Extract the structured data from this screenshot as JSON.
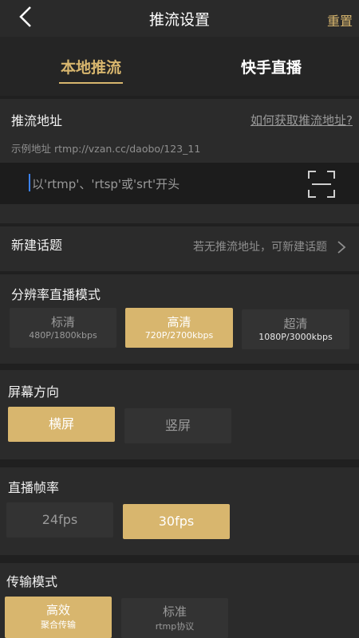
{
  "header": {
    "title": "推流设置",
    "reset_label": "重置"
  },
  "tabs": [
    {
      "label": "本地推流",
      "active": true
    },
    {
      "label": "快手直播",
      "active": false
    }
  ],
  "push_url": {
    "label": "推流地址",
    "help_link": "如何获取推流地址?",
    "example": "示例地址 rtmp://vzan.cc/daobo/123_11",
    "placeholder": "以'rtmp'、'rtsp'或'srt'开头",
    "value": ""
  },
  "new_topic": {
    "label": "新建话题",
    "hint": "若无推流地址，可新建话题"
  },
  "resolution": {
    "label": "分辨率直播模式",
    "options": [
      {
        "title": "标清",
        "sub": "480P/1800kbps"
      },
      {
        "title": "高清",
        "sub": "720P/2700kbps"
      },
      {
        "title": "超清",
        "sub": "1080P/3000kbps"
      }
    ],
    "selected": "高清"
  },
  "orientation": {
    "label": "屏幕方向",
    "options": [
      "横屏",
      "竖屏"
    ],
    "selected": "横屏"
  },
  "framerate": {
    "label": "直播帧率",
    "options": [
      "24fps",
      "30fps"
    ],
    "selected": "30fps"
  },
  "transport": {
    "label": "传输模式",
    "options": [
      {
        "title": "高效",
        "sub": "聚合传输"
      },
      {
        "title": "标准",
        "sub": "rtmp协议"
      }
    ],
    "selected": "高效"
  },
  "colors": {
    "accent": "#d8b66e",
    "background": "#202020",
    "card": "#2b2b2b"
  },
  "icons": {
    "back": "back-arrow-icon",
    "scan": "scan-icon",
    "chevron": "chevron-right-icon"
  }
}
